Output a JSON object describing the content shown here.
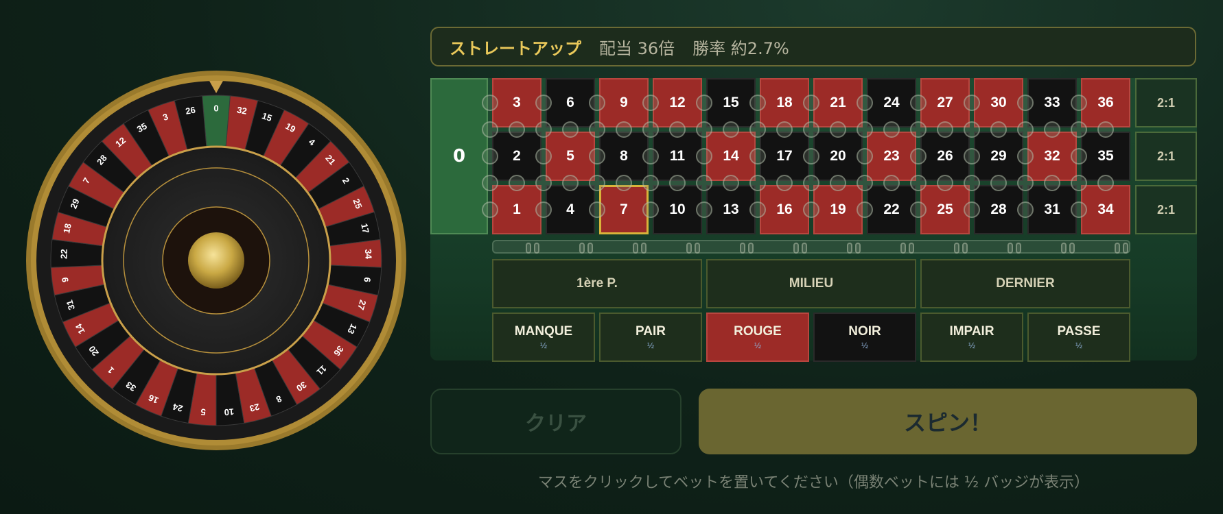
{
  "info_bar": {
    "bet_name": "ストレートアップ",
    "payout": "配当 36倍",
    "odds": "勝率 約2.7%"
  },
  "wheel": {
    "pockets": [
      "0",
      "32",
      "15",
      "19",
      "4",
      "21",
      "2",
      "25",
      "17",
      "34",
      "6",
      "27",
      "13",
      "36",
      "11",
      "30",
      "8",
      "23",
      "10",
      "5",
      "24",
      "16",
      "33",
      "1",
      "20",
      "14",
      "31",
      "9",
      "22",
      "18",
      "29",
      "7",
      "28",
      "12",
      "35",
      "3",
      "26"
    ],
    "red_numbers": [
      1,
      3,
      5,
      7,
      9,
      12,
      14,
      16,
      18,
      19,
      21,
      23,
      25,
      27,
      30,
      32,
      34,
      36
    ]
  },
  "table": {
    "zero_label": "0",
    "rows": [
      [
        "3",
        "6",
        "9",
        "12",
        "15",
        "18",
        "21",
        "24",
        "27",
        "30",
        "33",
        "36"
      ],
      [
        "2",
        "5",
        "8",
        "11",
        "14",
        "17",
        "20",
        "23",
        "26",
        "29",
        "32",
        "35"
      ],
      [
        "1",
        "4",
        "7",
        "10",
        "13",
        "16",
        "19",
        "22",
        "25",
        "28",
        "31",
        "34"
      ]
    ],
    "selected_number": "7",
    "column_bets": [
      "2:1",
      "2:1",
      "2:1"
    ],
    "dozens": [
      "1ère P.",
      "MILIEU",
      "DERNIER"
    ],
    "even_money": [
      {
        "label": "MANQUE",
        "badge": "½"
      },
      {
        "label": "PAIR",
        "badge": "½"
      },
      {
        "label": "ROUGE",
        "badge": "½"
      },
      {
        "label": "NOIR",
        "badge": "½"
      },
      {
        "label": "IMPAIR",
        "badge": "½"
      },
      {
        "label": "PASSE",
        "badge": "½"
      }
    ]
  },
  "buttons": {
    "clear": "クリア",
    "spin": "スピン！"
  },
  "hint": "マスをクリックしてベットを置いてください（偶数ベットには ½ バッジが表示）",
  "colors": {
    "red": "#9c2b27",
    "black": "#121212",
    "green": "#2c6a3c",
    "gold": "#c9a04a",
    "accent_text": "#e9c85a"
  }
}
